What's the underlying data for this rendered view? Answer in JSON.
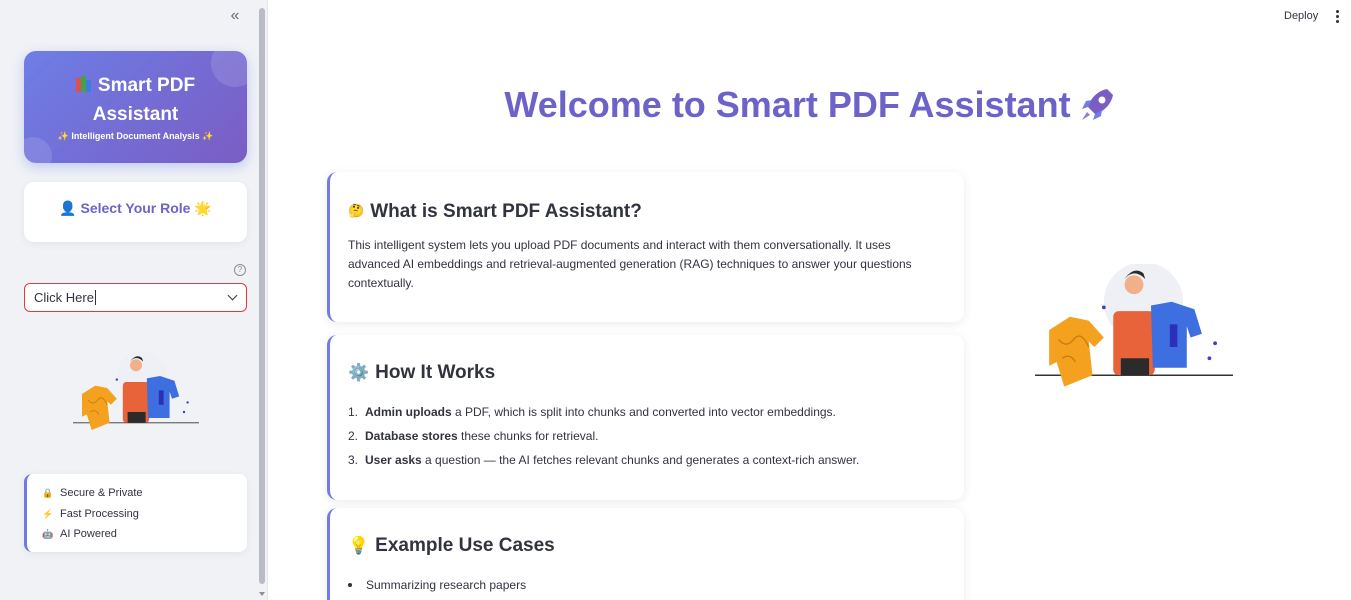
{
  "sidebar": {
    "brand": {
      "title_line1": "Smart PDF",
      "title_line2": "Assistant",
      "subtitle": "✨ Intelligent Document Analysis ✨",
      "icon": "books-icon"
    },
    "role_prompt": "👤 Select Your Role 🌟",
    "role_select": {
      "value": "Click Here",
      "help_icon": "question-circle-icon"
    },
    "features": [
      {
        "icon": "lock-icon",
        "glyph": "🔒",
        "label": "Secure & Private"
      },
      {
        "icon": "lightning-icon",
        "glyph": "⚡",
        "label": "Fast Processing"
      },
      {
        "icon": "robot-icon",
        "glyph": "🤖",
        "label": "AI Powered"
      }
    ]
  },
  "header": {
    "deploy_label": "Deploy",
    "menu_icon": "kebab-menu-icon"
  },
  "main": {
    "title": "Welcome to Smart PDF Assistant",
    "title_icon": "rocket-icon",
    "cards": {
      "what": {
        "emoji": "🤔",
        "heading": "What is Smart PDF Assistant?",
        "body": "This intelligent system lets you upload PDF documents and interact with them conversationally. It uses advanced AI embeddings and retrieval-augmented generation (RAG) techniques to answer your questions contextually."
      },
      "how": {
        "emoji": "⚙️",
        "heading": "How It Works",
        "steps": [
          {
            "num": "1.",
            "bold": "Admin uploads",
            "rest": " a PDF, which is split into chunks and converted into vector embeddings."
          },
          {
            "num": "2.",
            "bold": "Database stores",
            "rest": " these chunks for retrieval."
          },
          {
            "num": "3.",
            "bold": "User asks",
            "rest": " a question — the AI fetches relevant chunks and generates a context-rich answer."
          }
        ]
      },
      "examples": {
        "emoji": "💡",
        "heading": "Example Use Cases",
        "items": [
          "Summarizing research papers"
        ]
      }
    }
  },
  "colors": {
    "accent": "#6c63c8",
    "gradient_start": "#6d7ee6",
    "gradient_end": "#7a5dc4",
    "error_border": "#e0393e"
  }
}
